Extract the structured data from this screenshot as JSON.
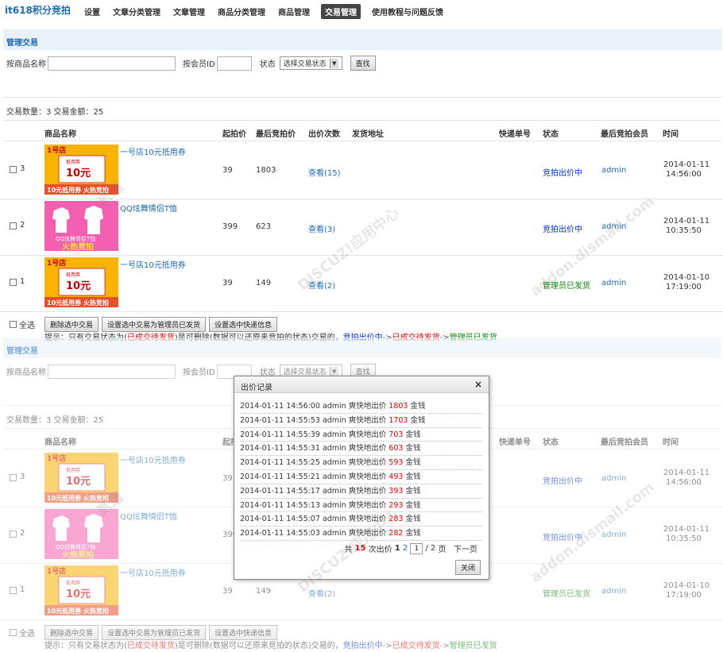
{
  "brand": "it618积分竞拍",
  "nav": [
    "设置",
    "文章分类管理",
    "文章管理",
    "商品分类管理",
    "商品管理",
    "交易管理",
    "使用教程与问题反馈"
  ],
  "nav_active": 5,
  "section_title": "管理交易",
  "filter": {
    "name_label": "按商品名称",
    "member_label": "按会员ID",
    "status_label": "状态",
    "status_value": "选择交易状态",
    "search_button": "查找"
  },
  "stats": "交易数量：3 交易金额：25",
  "columns": [
    "商品名称",
    "起拍价",
    "最后竞拍价",
    "出价次数",
    "发货地址",
    "快递单号",
    "状态",
    "最后竞拍会员",
    "时间"
  ],
  "rows": [
    {
      "id": "3",
      "name": "一号店10元抵用券",
      "thumb": "coupon",
      "start": "39",
      "last": "1803",
      "bids": "查看(15)",
      "status": "竞拍出价中",
      "status_type": "blue",
      "member": "admin",
      "date": "2014-01-11",
      "time": "14:56:00"
    },
    {
      "id": "2",
      "name": "QQ炫舞情侣T恤",
      "thumb": "tshirt",
      "start": "399",
      "last": "623",
      "bids": "查看(3)",
      "status": "竞拍出价中",
      "status_type": "blue",
      "member": "admin",
      "date": "2014-01-11",
      "time": "10:35:50"
    },
    {
      "id": "1",
      "name": "一号店10元抵用券",
      "thumb": "coupon",
      "start": "39",
      "last": "149",
      "bids": "查看(2)",
      "status": "管理员已发货",
      "status_type": "green",
      "member": "admin",
      "date": "2014-01-10",
      "time": "17:19:00"
    }
  ],
  "thumbs": {
    "coupon": {
      "top": "1号店",
      "face": "10元",
      "sub": "抵用券",
      "band": "10元抵用券 火热竞拍"
    },
    "tshirt": {
      "caption": "QQ炫舞情侣T恤",
      "band": "火热竞拍"
    }
  },
  "select_all": "全选",
  "actions": [
    "删除选中交易",
    "设置选中交易为管理员已发货",
    "设置选中快递信息"
  ],
  "hint": {
    "p1": "提示：只有交易状态为(",
    "p2": "已成交待发货",
    "p3": ")是可删除(数据可以还原来竞拍的状态)交易的，",
    "p4": "竞拍出价中",
    "p5": "->",
    "p6": "已成交待发货",
    "p7": "->",
    "p8": "管理员已发货"
  },
  "modal": {
    "title": "出价记录",
    "close_x": "×",
    "bid_text": "爽快地出价",
    "unit": "金钱",
    "logs": [
      {
        "time": "2014-01-11 14:56:00",
        "user": "admin",
        "amount": "1803"
      },
      {
        "time": "2014-01-11 14:55:53",
        "user": "admin",
        "amount": "1703"
      },
      {
        "time": "2014-01-11 14:55:39",
        "user": "admin",
        "amount": "703"
      },
      {
        "time": "2014-01-11 14:55:31",
        "user": "admin",
        "amount": "603"
      },
      {
        "time": "2014-01-11 14:55:25",
        "user": "admin",
        "amount": "593"
      },
      {
        "time": "2014-01-11 14:55:21",
        "user": "admin",
        "amount": "493"
      },
      {
        "time": "2014-01-11 14:55:17",
        "user": "admin",
        "amount": "393"
      },
      {
        "time": "2014-01-11 14:55:13",
        "user": "admin",
        "amount": "293"
      },
      {
        "time": "2014-01-11 14:55:07",
        "user": "admin",
        "amount": "283"
      },
      {
        "time": "2014-01-11 14:55:03",
        "user": "admin",
        "amount": "282"
      }
    ],
    "pager": {
      "prefix": "共",
      "total": "15",
      "mid": "次出价",
      "page_cur": "1",
      "page_next": "2",
      "input": "1",
      "slash": "/",
      "pages": "2",
      "suffix": "页",
      "next": "下一页"
    },
    "close_button": "关闭"
  },
  "watermark": [
    "DISCUZ!应用中心",
    "addon.dismall.com",
    "贰道"
  ]
}
